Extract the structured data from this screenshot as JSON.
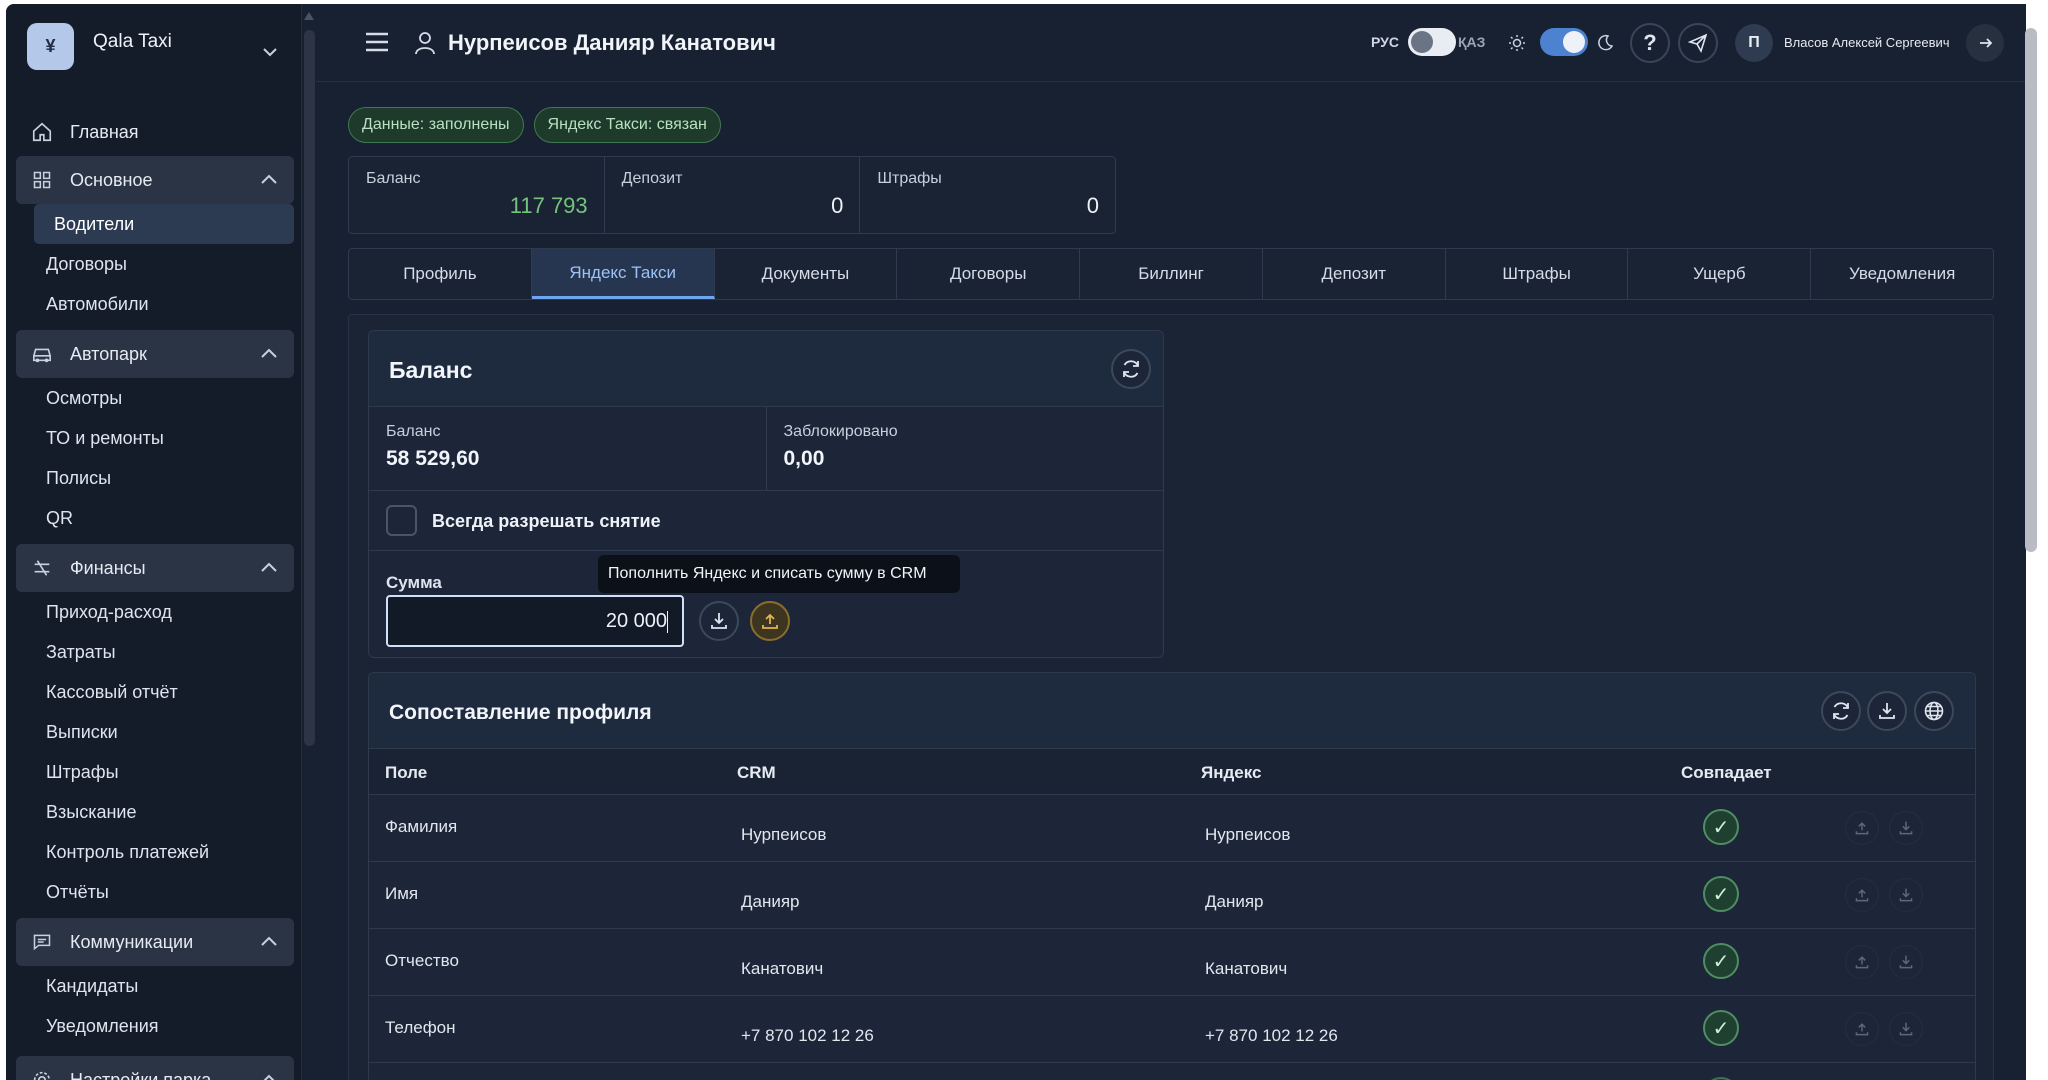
{
  "sidebar": {
    "brand": {
      "name": "Qala Taxi",
      "logo_glyph": "¥"
    },
    "items": [
      {
        "label": "Главная",
        "icon": "home-icon"
      },
      {
        "label": "Основное",
        "icon": "grid-icon",
        "subitems": [
          "Водители",
          "Договоры",
          "Автомобили"
        ],
        "active_sub": "Водители"
      },
      {
        "label": "Автопарк",
        "icon": "car-icon",
        "subitems": [
          "Осмотры",
          "ТО и ремонты",
          "Полисы",
          "QR"
        ]
      },
      {
        "label": "Финансы",
        "icon": "finance-icon",
        "subitems": [
          "Приход-расход",
          "Затраты",
          "Кассовый отчёт",
          "Выписки",
          "Штрафы",
          "Взыскание",
          "Контроль платежей",
          "Отчёты"
        ]
      },
      {
        "label": "Коммуникации",
        "icon": "message-icon",
        "subitems": [
          "Кандидаты",
          "Уведомления"
        ]
      },
      {
        "label": "Настройки парка",
        "icon": "gear-icon"
      }
    ]
  },
  "header": {
    "title": "Нурпеисов Данияр Канатович",
    "lang_ru": "РУС",
    "lang_kz": "ҚАЗ",
    "user_initial": "П",
    "user_name": "Власов Алексей Сергеевич"
  },
  "badges": [
    "Данные: заполнены",
    "Яндекс Такси: связан"
  ],
  "stats": [
    {
      "label": "Баланс",
      "value": "117 793"
    },
    {
      "label": "Депозит",
      "value": "0"
    },
    {
      "label": "Штрафы",
      "value": "0"
    }
  ],
  "tabs": [
    "Профиль",
    "Яндекс Такси",
    "Документы",
    "Договоры",
    "Биллинг",
    "Депозит",
    "Штрафы",
    "Ущерб",
    "Уведомления"
  ],
  "active_tab": "Яндекс Такси",
  "balance_card": {
    "title": "Баланс",
    "balance_label": "Баланс",
    "balance_value": "58 529,60",
    "blocked_label": "Заблокировано",
    "blocked_value": "0,00",
    "checkbox_label": "Всегда разрешать снятие",
    "sum_label": "Сумма",
    "sum_value": "20 000",
    "tooltip": "Пополнить Яндекс и списать сумму в CRM"
  },
  "mapping": {
    "title": "Сопоставление профиля",
    "columns": [
      "Поле",
      "CRM",
      "Яндекс",
      "Совпадает"
    ],
    "rows": [
      {
        "field": "Фамилия",
        "crm": "Нурпеисов",
        "yandex": "Нурпеисов",
        "match": "✓"
      },
      {
        "field": "Имя",
        "crm": "Данияр",
        "yandex": "Данияр",
        "match": "✓"
      },
      {
        "field": "Отчество",
        "crm": "Канатович",
        "yandex": "Канатович",
        "match": "✓"
      },
      {
        "field": "Телефон",
        "crm": "+7 870 102 12 26",
        "yandex": "+7 870 102 12 26",
        "match": "✓"
      }
    ]
  },
  "colors": {
    "accent": "#6ea5ee",
    "positive": "#74c37c",
    "upload_button": "#c99a2e"
  }
}
